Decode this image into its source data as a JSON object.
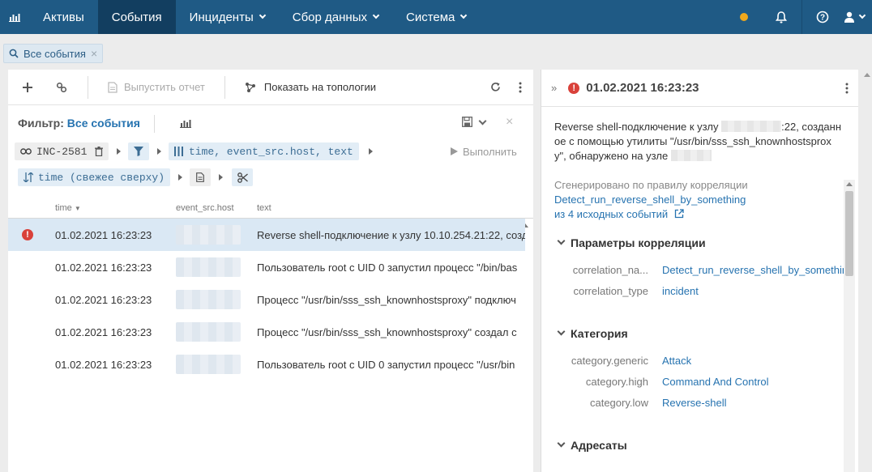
{
  "topnav": {
    "items": [
      {
        "label": "Активы",
        "active": false,
        "dropdown": false
      },
      {
        "label": "События",
        "active": true,
        "dropdown": false
      },
      {
        "label": "Инциденты",
        "active": false,
        "dropdown": true
      },
      {
        "label": "Сбор данных",
        "active": false,
        "dropdown": true
      },
      {
        "label": "Система",
        "active": false,
        "dropdown": true
      }
    ],
    "status_color": "#f0a81c"
  },
  "filter_chip": {
    "label": "Все события"
  },
  "toolbar": {
    "run_report_label": "Выпустить отчет",
    "show_topology_label": "Показать на топологии"
  },
  "filter": {
    "prefix": "Фильтр:",
    "name": "Все события",
    "incident_chip": "INC-2581",
    "columns_chip": "time, event_src.host, text",
    "sort_chip": "time (свежее сверху)",
    "run_label": "Выполнить"
  },
  "table": {
    "columns": [
      "time",
      "event_src.host",
      "text"
    ],
    "rows": [
      {
        "time": "01.02.2021 16:23:23",
        "text": "Reverse shell-подключение к узлу 10.10.254.21:22, созд",
        "error": true,
        "selected": true
      },
      {
        "time": "01.02.2021 16:23:23",
        "text": "Пользователь root с UID 0 запустил процесс \"/bin/bas",
        "error": false,
        "selected": false
      },
      {
        "time": "01.02.2021 16:23:23",
        "text": "Процесс \"/usr/bin/sss_ssh_knownhostsproxy\" подключ",
        "error": false,
        "selected": false
      },
      {
        "time": "01.02.2021 16:23:23",
        "text": "Процесс \"/usr/bin/sss_ssh_knownhostsproxy\" создал с",
        "error": false,
        "selected": false
      },
      {
        "time": "01.02.2021 16:23:23",
        "text": "Пользователь root с UID 0 запустил процесс \"/usr/bin",
        "error": false,
        "selected": false
      }
    ]
  },
  "detail": {
    "title": "01.02.2021 16:23:23",
    "desc_line1_a": "Reverse shell-подключение к узлу ",
    "desc_line1_b": ":22, созданн",
    "desc_line2": "ое с помощью утилиты \"/usr/bin/sss_ssh_knownhostsprox",
    "desc_line3": "y\", обнаружено на узле ",
    "generated_by": "Сгенерировано по правилу корреляции",
    "rule_link": "Detect_run_reverse_shell_by_something",
    "sources_link": "из 4 исходных событий",
    "sections": {
      "correlation": {
        "title": "Параметры корреляции",
        "rows": [
          {
            "key": "correlation_na...",
            "value": "Detect_run_reverse_shell_by_something"
          },
          {
            "key": "correlation_type",
            "value": "incident"
          }
        ]
      },
      "category": {
        "title": "Категория",
        "rows": [
          {
            "key": "category.generic",
            "value": "Attack"
          },
          {
            "key": "category.high",
            "value": "Command And Control"
          },
          {
            "key": "category.low",
            "value": "Reverse-shell"
          }
        ]
      },
      "addressees": {
        "title": "Адресаты"
      }
    }
  }
}
